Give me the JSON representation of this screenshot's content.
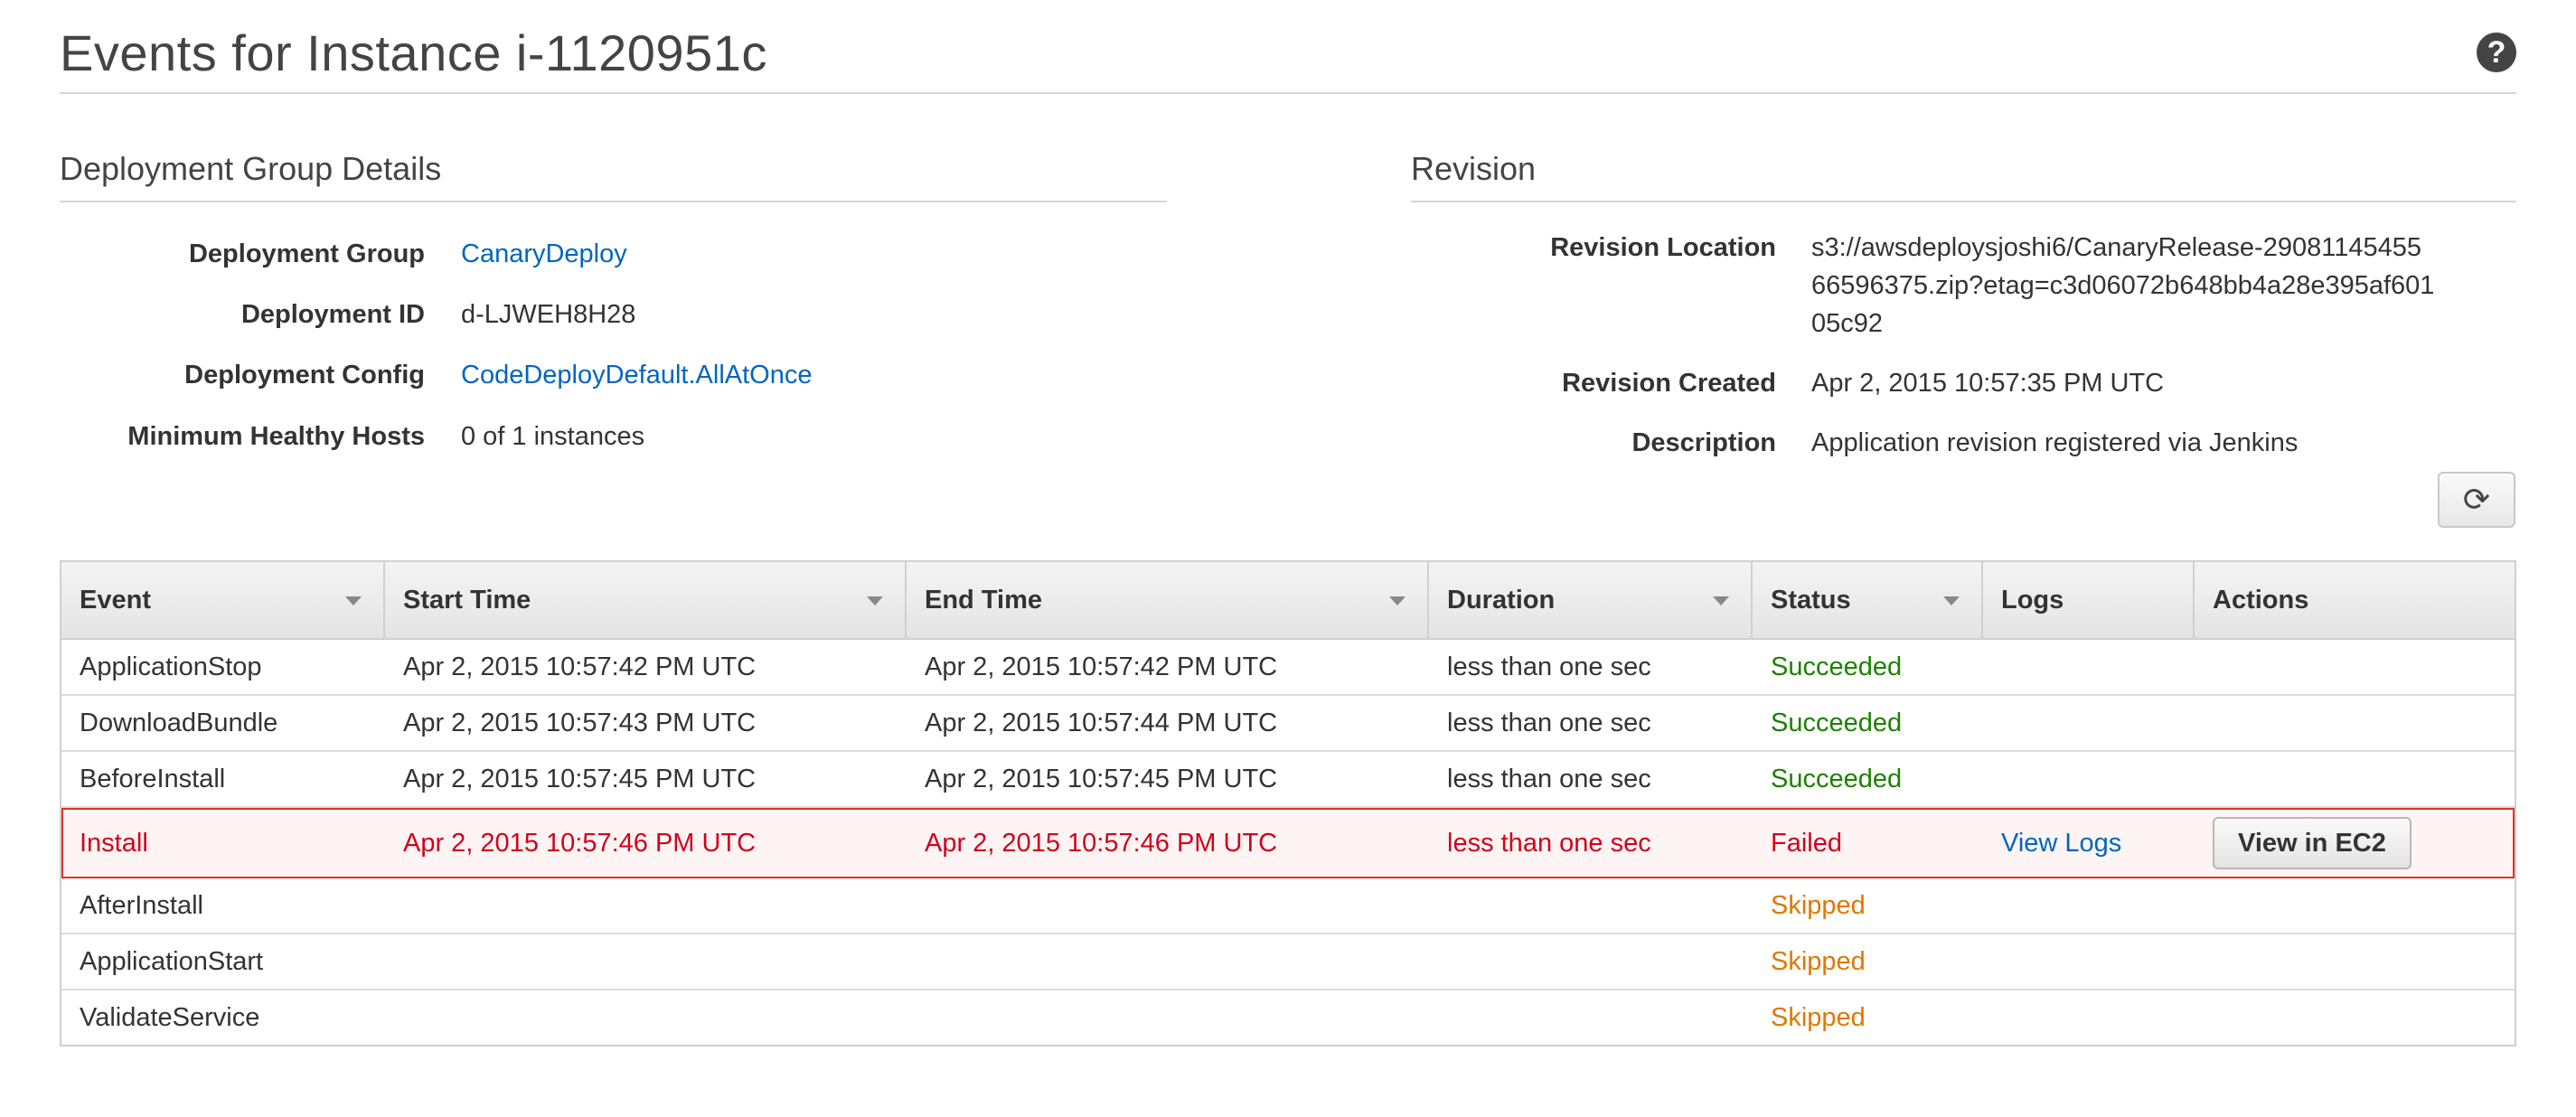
{
  "page": {
    "title": "Events for Instance i-1120951c",
    "help_icon": "help-circle-icon"
  },
  "deployment_group": {
    "section_title": "Deployment Group Details",
    "rows": [
      {
        "label": "Deployment Group",
        "value": "CanaryDeploy"
      },
      {
        "label": "Deployment ID",
        "value": "d-LJWEH8H28"
      },
      {
        "label": "Deployment Config",
        "value": "CodeDeployDefault.AllAtOnce"
      },
      {
        "label": "Minimum Healthy Hosts",
        "value": "0 of 1 instances"
      }
    ]
  },
  "revision": {
    "section_title": "Revision",
    "location_label": "Revision Location",
    "location_lines": [
      "s3://awsdeploysjoshi6/CanaryRelease-29081145455",
      "66596375.zip?etag=c3d06072b648bb4a28e395af601",
      "05c92"
    ],
    "created_label": "Revision Created",
    "created_value": "Apr 2, 2015 10:57:35 PM UTC",
    "description_label": "Description",
    "description_value": "Application revision registered via Jenkins"
  },
  "refresh_icon": "refresh-icon",
  "table": {
    "columns": [
      "Event",
      "Start Time",
      "End Time",
      "Duration",
      "Status",
      "Logs",
      "Actions"
    ],
    "rows": [
      {
        "event": "ApplicationStop",
        "start": "Apr 2, 2015 10:57:42 PM UTC",
        "end": "Apr 2, 2015 10:57:42 PM UTC",
        "duration": "less than one sec",
        "status": "Succeeded",
        "logs": "",
        "action": ""
      },
      {
        "event": "DownloadBundle",
        "start": "Apr 2, 2015 10:57:43 PM UTC",
        "end": "Apr 2, 2015 10:57:44 PM UTC",
        "duration": "less than one sec",
        "status": "Succeeded",
        "logs": "",
        "action": ""
      },
      {
        "event": "BeforeInstall",
        "start": "Apr 2, 2015 10:57:45 PM UTC",
        "end": "Apr 2, 2015 10:57:45 PM UTC",
        "duration": "less than one sec",
        "status": "Succeeded",
        "logs": "",
        "action": ""
      },
      {
        "event": "Install",
        "start": "Apr 2, 2015 10:57:46 PM UTC",
        "end": "Apr 2, 2015 10:57:46 PM UTC",
        "duration": "less than one sec",
        "status": "Failed",
        "logs": "View Logs",
        "action": "View in EC2"
      },
      {
        "event": "AfterInstall",
        "start": "",
        "end": "",
        "duration": "",
        "status": "Skipped",
        "logs": "",
        "action": ""
      },
      {
        "event": "ApplicationStart",
        "start": "",
        "end": "",
        "duration": "",
        "status": "Skipped",
        "logs": "",
        "action": ""
      },
      {
        "event": "ValidateService",
        "start": "",
        "end": "",
        "duration": "",
        "status": "Skipped",
        "logs": "",
        "action": ""
      }
    ]
  },
  "colors": {
    "link": "#0066c0",
    "succeeded": "#1d8102",
    "failed": "#d0021b",
    "skipped": "#e07700"
  }
}
